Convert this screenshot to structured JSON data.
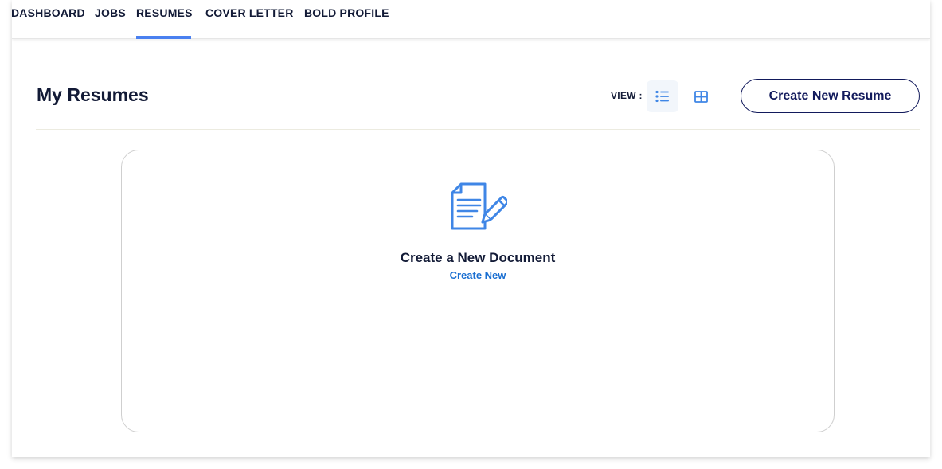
{
  "nav": {
    "items": [
      {
        "label": "DASHBOARD",
        "active": false
      },
      {
        "label": "JOBS",
        "active": false
      },
      {
        "label": "RESUMES",
        "active": true
      },
      {
        "label": "COVER LETTER",
        "active": false
      },
      {
        "label": "BOLD PROFILE",
        "active": false
      }
    ],
    "active_color": "#4a80f0"
  },
  "header": {
    "title": "My Resumes",
    "view_label": "VIEW :",
    "view_options": [
      {
        "icon": "list-view-icon",
        "active": true
      },
      {
        "icon": "grid-view-icon",
        "active": false
      }
    ],
    "create_button_label": "Create New Resume"
  },
  "empty_card": {
    "icon": "document-edit-icon",
    "title": "Create a New Document",
    "link_label": "Create New"
  },
  "colors": {
    "text": "#121a36",
    "link": "#1a6fd1",
    "icon_blue": "#3f86e6",
    "button_border": "#121a5c"
  }
}
